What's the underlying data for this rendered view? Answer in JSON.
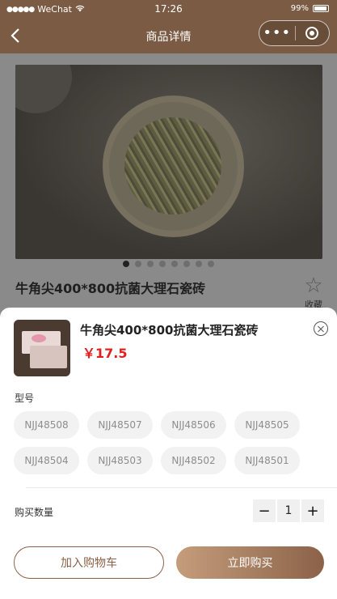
{
  "status_bar": {
    "carrier": "WeChat",
    "time": "17:26",
    "battery": "99%"
  },
  "nav": {
    "title": "商品详情"
  },
  "product_page": {
    "title": "牛角尖400*800抗菌大理石瓷砖",
    "favorite_label": "收藏",
    "carousel_count": 8,
    "carousel_active_index": 0
  },
  "sheet": {
    "product_name": "牛角尖400*800抗菌大理石瓷砖",
    "price": "￥17.5",
    "model_label": "型号",
    "models": [
      "NJJ48508",
      "NJJ48507",
      "NJJ48506",
      "NJJ48505",
      "NJJ48504",
      "NJJ48503",
      "NJJ48502",
      "NJJ48501"
    ],
    "quantity_label": "购买数量",
    "quantity": "1",
    "minus": "−",
    "plus": "+",
    "add_to_cart": "加入购物车",
    "buy_now": "立即购买"
  },
  "colors": {
    "brand_brown": "#7b5b43",
    "price_red": "#e02020"
  }
}
